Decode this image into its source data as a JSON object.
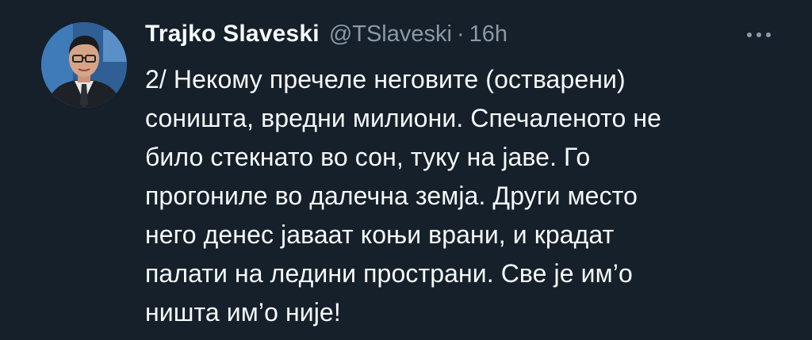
{
  "tweet": {
    "author": {
      "display_name": "Trajko Slaveski",
      "handle": "@TSlaveski",
      "avatar": "profile-photo"
    },
    "separator": "·",
    "timestamp": "16h",
    "more_icon": "more-horizontal-icon",
    "text_lines": [
      "2/ Некому пречеле неговите (остварени)",
      "соништа, вредни милиони. Спечаленото не",
      "било стекнато во сон, туку на јаве. Го",
      "прогониле во далечна земја. Други место",
      "него денес јаваат коњи врани, и крадат",
      "палати на ледини пространи. Све је им’о",
      "ништа им’о није!"
    ]
  },
  "colors": {
    "background": "#15202b",
    "primary_text": "#f7f9f9",
    "secondary_text": "#8b98a5"
  }
}
